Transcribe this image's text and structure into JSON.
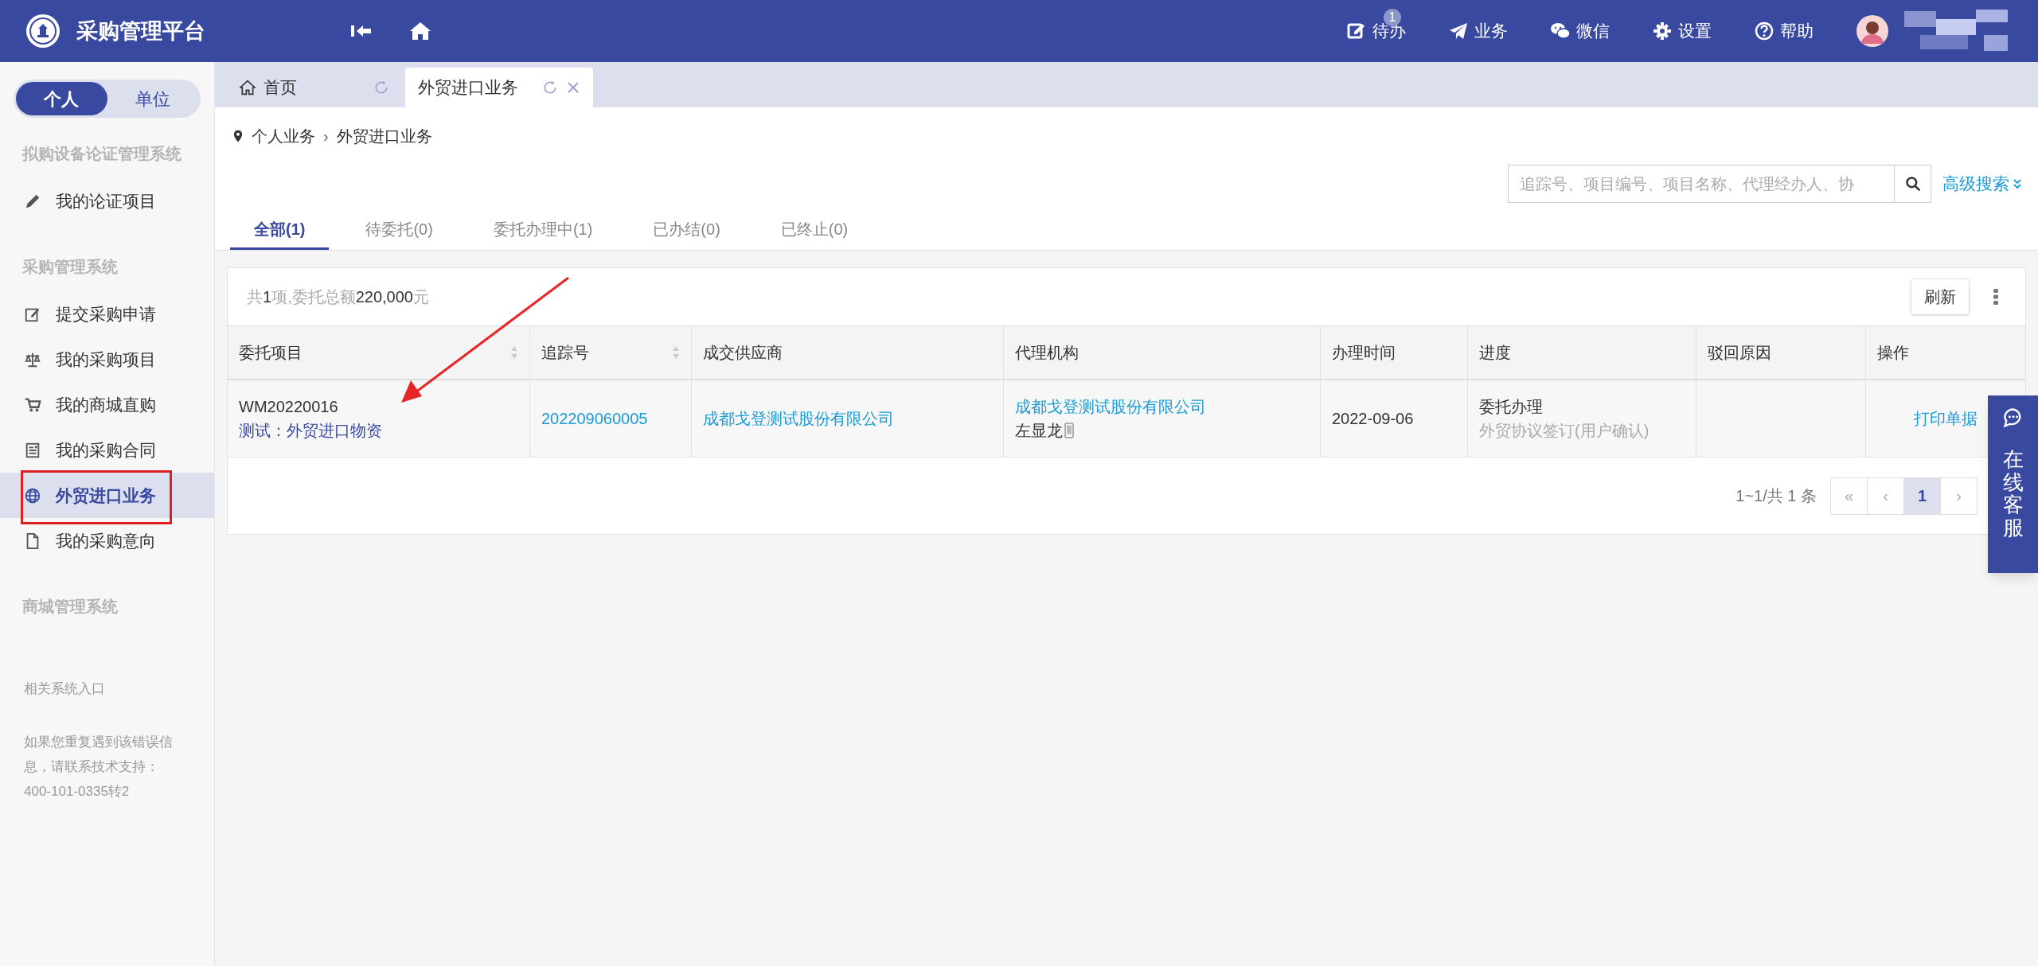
{
  "header": {
    "title": "采购管理平台",
    "nav": [
      {
        "label": "待办",
        "badge": "1"
      },
      {
        "label": "业务"
      },
      {
        "label": "微信"
      },
      {
        "label": "设置"
      },
      {
        "label": "帮助"
      }
    ]
  },
  "sidebar": {
    "toggle": [
      {
        "label": "个人",
        "selected": true
      },
      {
        "label": "单位",
        "selected": false
      }
    ],
    "sections": [
      {
        "title": "拟购设备论证管理系统",
        "items": [
          {
            "label": "我的论证项目",
            "selected": false
          }
        ]
      },
      {
        "title": "采购管理系统",
        "items": [
          {
            "label": "提交采购申请",
            "selected": false
          },
          {
            "label": "我的采购项目",
            "selected": false
          },
          {
            "label": "我的商城直购",
            "selected": false
          },
          {
            "label": "我的采购合同",
            "selected": false
          },
          {
            "label": "外贸进口业务",
            "selected": true
          },
          {
            "label": "我的采购意向",
            "selected": false
          }
        ]
      },
      {
        "title": "商城管理系统"
      }
    ],
    "footer_title": "相关系统入口",
    "footer_text": "如果您重复遇到该错误信息，请联系技术支持：400-101-0335转2"
  },
  "page_tabs": [
    {
      "label": "首页",
      "selected": false,
      "closable": false
    },
    {
      "label": "外贸进口业务",
      "selected": true,
      "closable": true
    }
  ],
  "breadcrumb": {
    "separator": "›",
    "items": [
      "个人业务",
      "外贸进口业务"
    ]
  },
  "search": {
    "placeholder": "追踪号、项目编号、项目名称、代理经办人、协",
    "advanced": "高级搜索"
  },
  "filter_tabs": [
    {
      "label": "全部(1)",
      "selected": true
    },
    {
      "label": "待委托(0)",
      "selected": false
    },
    {
      "label": "委托办理中(1)",
      "selected": false
    },
    {
      "label": "已办结(0)",
      "selected": false
    },
    {
      "label": "已终止(0)",
      "selected": false
    }
  ],
  "table": {
    "summary": "共**1**项,委托总额**220,000**元",
    "refresh": "刷新",
    "columns": [
      {
        "label": "委托项目",
        "sortable": true
      },
      {
        "label": "追踪号",
        "sortable": true
      },
      {
        "label": "成交供应商",
        "sortable": false
      },
      {
        "label": "代理机构",
        "sortable": false
      },
      {
        "label": "办理时间",
        "sortable": false
      },
      {
        "label": "进度",
        "sortable": false
      },
      {
        "label": "驳回原因",
        "sortable": false
      },
      {
        "label": "操作",
        "sortable": false
      }
    ],
    "rows": [
      {
        "project_code": "WM20220016",
        "project_name": "测试：外贸进口物资",
        "tracking_no": "202209060005",
        "supplier": "成都戈登测试股份有限公司",
        "agency": "成都戈登测试股份有限公司",
        "agent": "左显龙",
        "date": "2022-09-06",
        "progress": "委托办理",
        "progress_detail": "外贸协议签订(用户确认)",
        "action": "打印单据"
      }
    ]
  },
  "pagination": {
    "summary": "1~1/共 1 条",
    "pages": [
      {
        "label": "«",
        "selected": false
      },
      {
        "label": "‹",
        "selected": false
      },
      {
        "label": "1",
        "selected": true
      },
      {
        "label": "›",
        "selected": false
      }
    ]
  },
  "service": {
    "label": "在线客服"
  }
}
